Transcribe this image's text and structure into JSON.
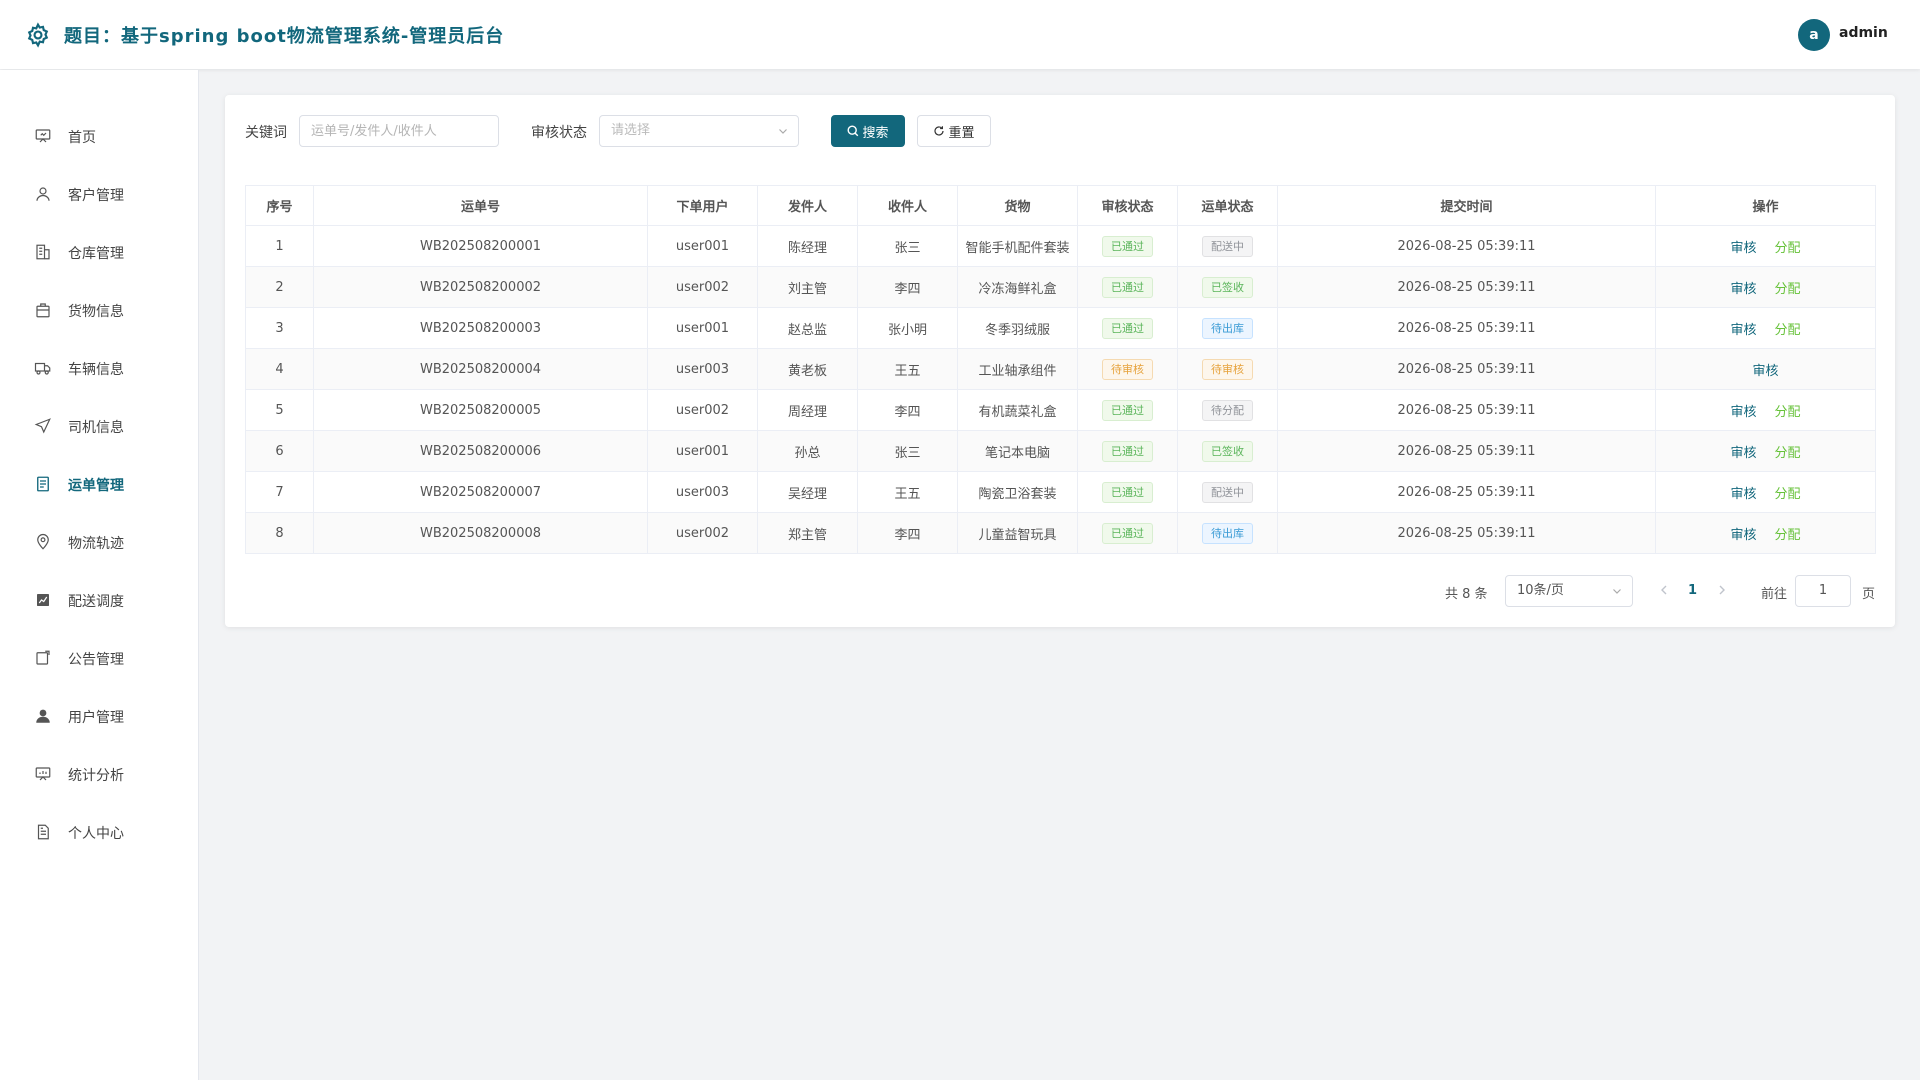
{
  "header": {
    "title": "题目：基于spring boot物流管理系统-管理员后台",
    "avatar_letter": "a",
    "username": "admin",
    "logo_icon": "gear-icon"
  },
  "sidebar": {
    "items": [
      {
        "label": "首页",
        "icon": "presentation-icon",
        "active": false
      },
      {
        "label": "客户管理",
        "icon": "user-icon",
        "active": false
      },
      {
        "label": "仓库管理",
        "icon": "building-icon",
        "active": false
      },
      {
        "label": "货物信息",
        "icon": "box-icon",
        "active": false
      },
      {
        "label": "车辆信息",
        "icon": "truck-icon",
        "active": false
      },
      {
        "label": "司机信息",
        "icon": "navigation-icon",
        "active": false
      },
      {
        "label": "运单管理",
        "icon": "document-icon",
        "active": true
      },
      {
        "label": "物流轨迹",
        "icon": "location-pin-icon",
        "active": false
      },
      {
        "label": "配送调度",
        "icon": "chart-icon",
        "active": false
      },
      {
        "label": "公告管理",
        "icon": "notice-icon",
        "active": false
      },
      {
        "label": "用户管理",
        "icon": "user-filled-icon",
        "active": false
      },
      {
        "label": "统计分析",
        "icon": "stats-board-icon",
        "active": false
      },
      {
        "label": "个人中心",
        "icon": "profile-doc-icon",
        "active": false
      }
    ]
  },
  "filters": {
    "keyword_label": "关键词",
    "keyword_placeholder": "运单号/发件人/收件人",
    "status_label": "审核状态",
    "status_placeholder": "请选择",
    "search_label": "搜索",
    "reset_label": "重置"
  },
  "table": {
    "columns": [
      "序号",
      "运单号",
      "下单用户",
      "发件人",
      "收件人",
      "货物",
      "审核状态",
      "运单状态",
      "提交时间",
      "操作"
    ],
    "rows": [
      {
        "no": "1",
        "waybill": "WB202508200001",
        "user": "user001",
        "sender": "陈经理",
        "receiver": "张三",
        "goods": "智能手机配件套装",
        "audit": "已通过",
        "audit_type": "success",
        "status": "配送中",
        "status_type": "info",
        "time": "2026-08-25 05:39:11",
        "ops": [
          "审核",
          "分配"
        ]
      },
      {
        "no": "2",
        "waybill": "WB202508200002",
        "user": "user002",
        "sender": "刘主管",
        "receiver": "李四",
        "goods": "冷冻海鲜礼盒",
        "audit": "已通过",
        "audit_type": "success",
        "status": "已签收",
        "status_type": "success",
        "time": "2026-08-25 05:39:11",
        "ops": [
          "审核",
          "分配"
        ]
      },
      {
        "no": "3",
        "waybill": "WB202508200003",
        "user": "user001",
        "sender": "赵总监",
        "receiver": "张小明",
        "goods": "冬季羽绒服",
        "audit": "已通过",
        "audit_type": "success",
        "status": "待出库",
        "status_type": "primary",
        "time": "2026-08-25 05:39:11",
        "ops": [
          "审核",
          "分配"
        ]
      },
      {
        "no": "4",
        "waybill": "WB202508200004",
        "user": "user003",
        "sender": "黄老板",
        "receiver": "王五",
        "goods": "工业轴承组件",
        "audit": "待审核",
        "audit_type": "warning",
        "status": "待审核",
        "status_type": "warning",
        "time": "2026-08-25 05:39:11",
        "ops": [
          "审核"
        ]
      },
      {
        "no": "5",
        "waybill": "WB202508200005",
        "user": "user002",
        "sender": "周经理",
        "receiver": "李四",
        "goods": "有机蔬菜礼盒",
        "audit": "已通过",
        "audit_type": "success",
        "status": "待分配",
        "status_type": "info",
        "time": "2026-08-25 05:39:11",
        "ops": [
          "审核",
          "分配"
        ]
      },
      {
        "no": "6",
        "waybill": "WB202508200006",
        "user": "user001",
        "sender": "孙总",
        "receiver": "张三",
        "goods": "笔记本电脑",
        "audit": "已通过",
        "audit_type": "success",
        "status": "已签收",
        "status_type": "success",
        "time": "2026-08-25 05:39:11",
        "ops": [
          "审核",
          "分配"
        ]
      },
      {
        "no": "7",
        "waybill": "WB202508200007",
        "user": "user003",
        "sender": "吴经理",
        "receiver": "王五",
        "goods": "陶瓷卫浴套装",
        "audit": "已通过",
        "audit_type": "success",
        "status": "配送中",
        "status_type": "info",
        "time": "2026-08-25 05:39:11",
        "ops": [
          "审核",
          "分配"
        ]
      },
      {
        "no": "8",
        "waybill": "WB202508200008",
        "user": "user002",
        "sender": "郑主管",
        "receiver": "李四",
        "goods": "儿童益智玩具",
        "audit": "已通过",
        "audit_type": "success",
        "status": "待出库",
        "status_type": "primary",
        "time": "2026-08-25 05:39:11",
        "ops": [
          "审核",
          "分配"
        ]
      }
    ]
  },
  "pagination": {
    "total_text": "共 8 条",
    "page_size": "10条/页",
    "current_page": "1",
    "goto_label": "前往",
    "goto_value": "1",
    "page_suffix": "页"
  },
  "colors": {
    "brand": "#12677c",
    "success": "#67c23a",
    "warning": "#e6a23c"
  }
}
